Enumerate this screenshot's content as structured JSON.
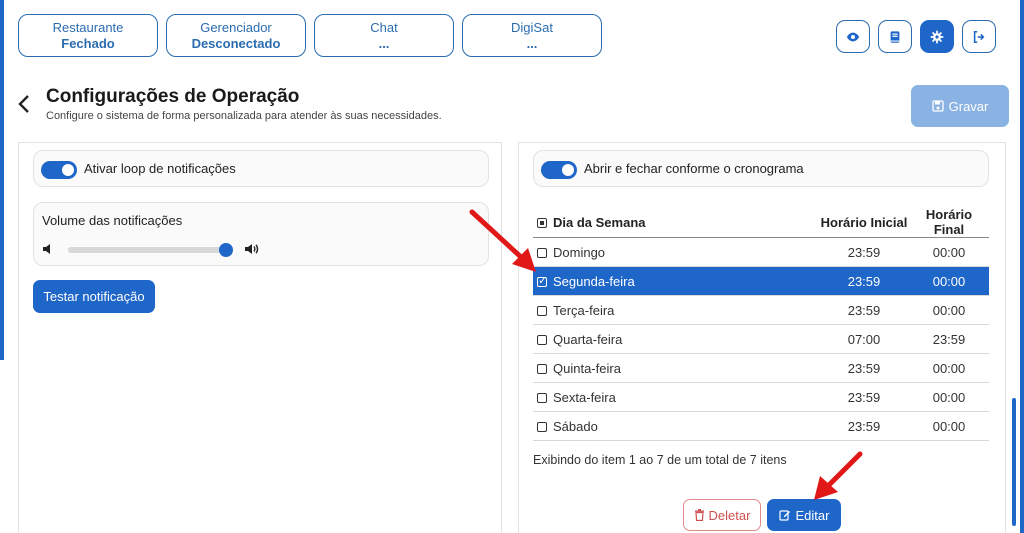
{
  "status_tabs": [
    {
      "label": "Restaurante",
      "value": "Fechado"
    },
    {
      "label": "Gerenciador",
      "value": "Desconectado"
    },
    {
      "label": "Chat",
      "value": "..."
    },
    {
      "label": "DigiSat",
      "value": "..."
    }
  ],
  "top_icons": [
    {
      "name": "eye-icon",
      "active": false
    },
    {
      "name": "book-icon",
      "active": false
    },
    {
      "name": "gear-icon",
      "active": true
    },
    {
      "name": "logout-icon",
      "active": false
    }
  ],
  "page": {
    "title": "Configurações de Operação",
    "subtitle": "Configure o sistema de forma personalizada para atender às suas necessidades.",
    "save_label": "Gravar"
  },
  "left_panel": {
    "loop_label": "Ativar loop de notificações",
    "loop_enabled": true,
    "volume_label": "Volume das notificações",
    "volume_level": 1.0,
    "test_button": "Testar notificação"
  },
  "right_panel": {
    "schedule_label": "Abrir e fechar conforme o cronograma",
    "schedule_enabled": true,
    "table": {
      "headers": [
        "Dia da Semana",
        "Horário Inicial",
        "Horário Final"
      ],
      "rows": [
        {
          "day": "Domingo",
          "start": "23:59",
          "end": "00:00",
          "selected": false
        },
        {
          "day": "Segunda-feira",
          "start": "23:59",
          "end": "00:00",
          "selected": true
        },
        {
          "day": "Terça-feira",
          "start": "23:59",
          "end": "00:00",
          "selected": false
        },
        {
          "day": "Quarta-feira",
          "start": "07:00",
          "end": "23:59",
          "selected": false
        },
        {
          "day": "Quinta-feira",
          "start": "23:59",
          "end": "00:00",
          "selected": false
        },
        {
          "day": "Sexta-feira",
          "start": "23:59",
          "end": "00:00",
          "selected": false
        },
        {
          "day": "Sábado",
          "start": "23:59",
          "end": "00:00",
          "selected": false
        }
      ]
    },
    "pager_text": "Exibindo do item 1 ao 7 de um total de 7 itens",
    "delete_label": "Deletar",
    "edit_label": "Editar"
  },
  "colors": {
    "primary": "#1f66c9",
    "primary_light": "#8ab3e4",
    "danger": "#d05050",
    "arrow": "#e01818"
  }
}
